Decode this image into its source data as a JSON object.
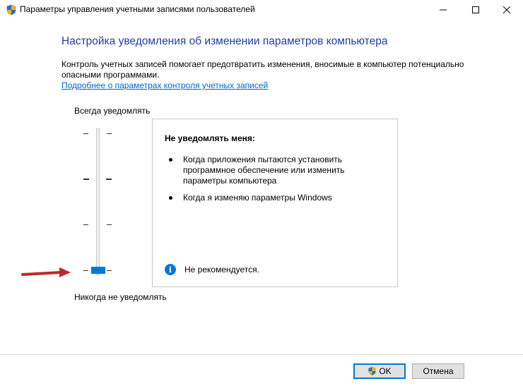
{
  "window": {
    "title": "Параметры управления учетными записями пользователей",
    "icon": "uac-shield-icon",
    "controls": [
      "minimize-icon",
      "maximize-icon",
      "close-icon"
    ]
  },
  "main": {
    "heading": "Настройка уведомления об изменении параметров компьютера",
    "description": "Контроль учетных записей помогает предотвратить изменения, вносимые в компьютер потенциально опасными программами.",
    "link": "Подробнее о параметрах контроля учетных записей"
  },
  "slider": {
    "label_top": "Всегда уведомлять",
    "label_bottom": "Никогда не уведомлять",
    "levels": 4,
    "selected_level": 1,
    "accent": "#0078d7"
  },
  "info": {
    "title": "Не уведомлять меня:",
    "items": [
      "Когда приложения пытаются установить программное обеспечение или изменить параметры компьютера",
      "Когда я изменяю параметры Windows"
    ],
    "note": "Не рекомендуется.",
    "note_icon": "info-icon"
  },
  "annotations": {
    "arrow_color": "#c0272d"
  },
  "buttons": {
    "ok_label": "OK",
    "cancel_label": "Отмена"
  }
}
